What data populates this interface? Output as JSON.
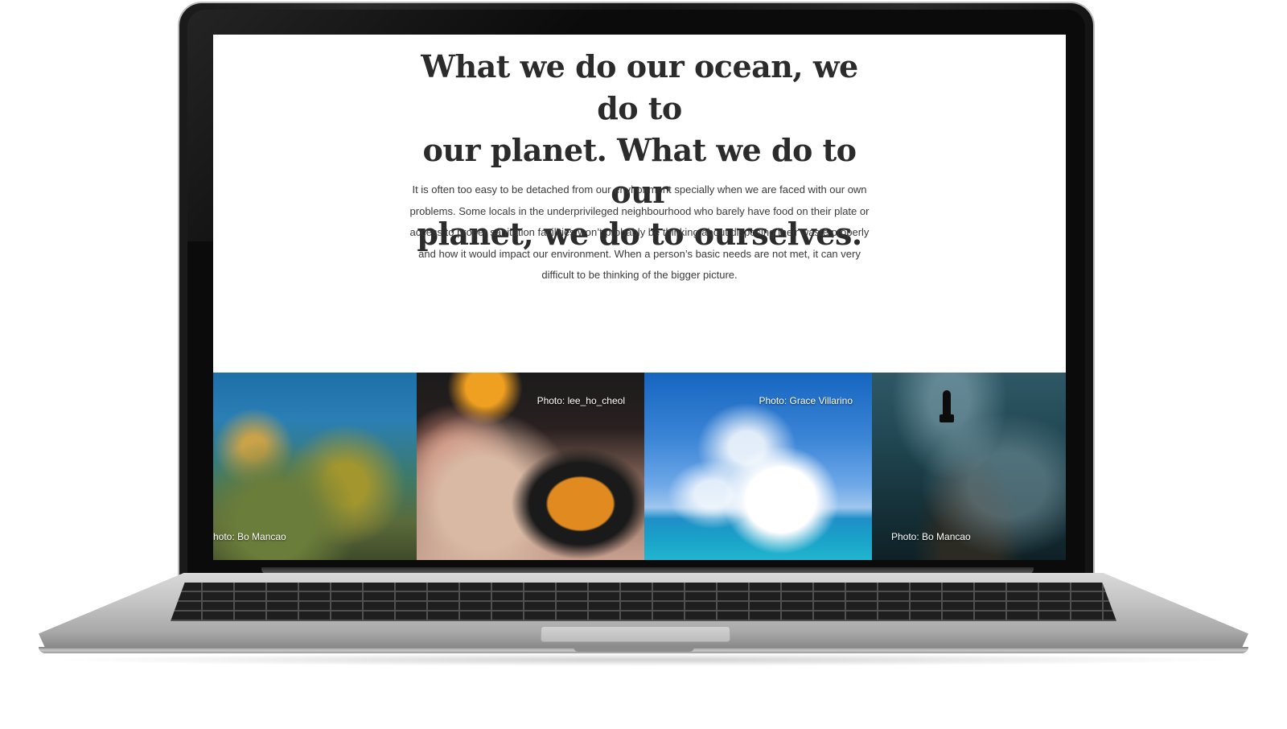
{
  "content": {
    "headline": "What we do our ocean, we do to\nour planet. What we do to our\nplanet, we do to ourselves.",
    "body": "It is often too easy to be detached from our environment specially when we are faced with our own problems. Some locals in the underprivileged neighbourhood who barely have food on their plate or access to proper sanitation facilities won’t probably be thinking about disposing their waste properly and how it would impact our environment.  When a person’s basic needs are not met, it can very difficult to be thinking of the bigger picture."
  },
  "photos": [
    {
      "caption": "hoto: Bo Mancao",
      "subject": "coral reef with fish school"
    },
    {
      "caption": "Photo: lee_ho_cheol",
      "subject": "clownfish in anemone"
    },
    {
      "caption": "Photo: Grace Villarino",
      "subject": "sky and sea with boat"
    },
    {
      "caption": "Photo: Bo Mancao",
      "subject": "freediver with sardine school"
    }
  ],
  "colors": {
    "headline": "#2b2b2b",
    "body_text": "#3a3a3a",
    "screen_background": "#ffffff",
    "laptop_frame": "#1a1a1a",
    "laptop_base": "#c4c4c4"
  }
}
